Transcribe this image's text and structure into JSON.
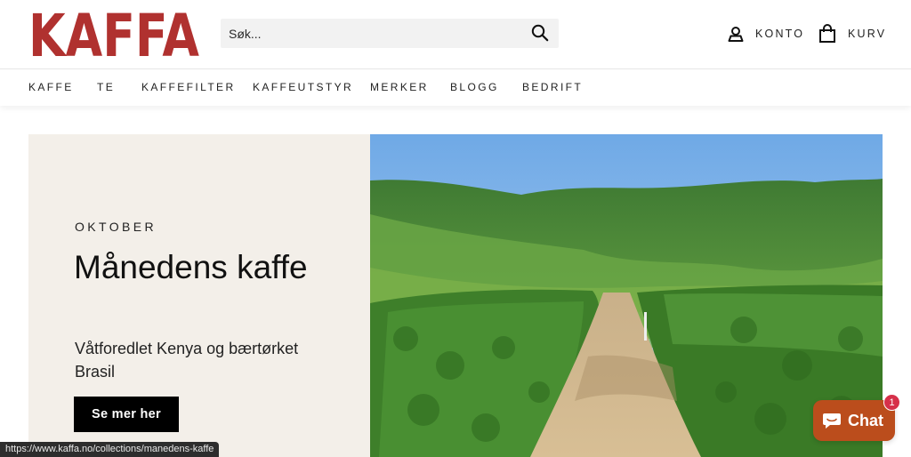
{
  "brand": {
    "logo_text": "KAFFA",
    "logo_color": "#b0312f"
  },
  "search": {
    "placeholder": "Søk..."
  },
  "header": {
    "account_label": "KONTO",
    "cart_label": "KURV"
  },
  "nav": {
    "items": [
      {
        "label": "KAFFE"
      },
      {
        "label": "TE"
      },
      {
        "label": "KAFFEFILTER"
      },
      {
        "label": "KAFFEUTSTYR"
      },
      {
        "label": "MERKER"
      },
      {
        "label": "BLOGG"
      },
      {
        "label": "BEDRIFT"
      }
    ]
  },
  "hero": {
    "eyebrow": "OKTOBER",
    "title": "Månedens kaffe",
    "subtitle": "Våtforedlet Kenya og bærtørket Brasil",
    "cta_label": "Se mer her",
    "image": "coffee-plantation-photo"
  },
  "status_bar": {
    "url": "https://www.kaffa.no/collections/manedens-kaffe"
  },
  "chat": {
    "label": "Chat",
    "badge_count": "1",
    "color": "#bb4d1c"
  },
  "colors": {
    "accent": "#b0312f",
    "hero_bg": "#f3efe9",
    "button": "#000000"
  }
}
